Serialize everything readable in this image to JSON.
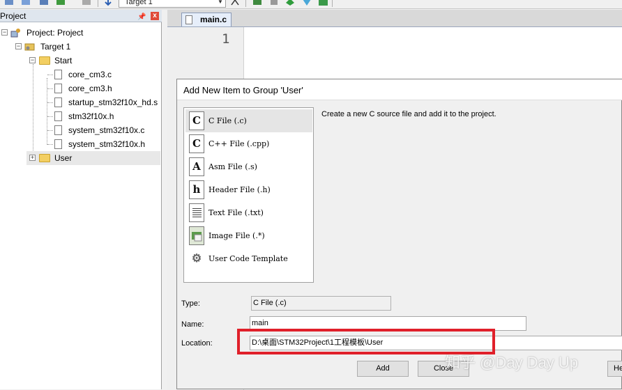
{
  "toolbar": {
    "target_select": "Target 1"
  },
  "project_pane": {
    "title": "Project",
    "pin": "ᵖ",
    "close": "x",
    "tree": {
      "root": "Project: Project",
      "target": "Target 1",
      "group_start": "Start",
      "files": [
        "core_cm3.c",
        "core_cm3.h",
        "startup_stm32f10x_hd.s",
        "stm32f10x.h",
        "system_stm32f10x.c",
        "system_stm32f10x.h"
      ],
      "group_user": "User"
    }
  },
  "editor": {
    "tab_label": "main.c",
    "line_number": "1"
  },
  "dialog": {
    "title": "Add New Item to Group 'User'",
    "items": [
      {
        "label": "C File (.c)",
        "icon": "C"
      },
      {
        "label": "C++ File (.cpp)",
        "icon": "C"
      },
      {
        "label": "Asm File (.s)",
        "icon": "A"
      },
      {
        "label": "Header File (.h)",
        "icon": "h"
      },
      {
        "label": "Text File (.txt)",
        "icon": ""
      },
      {
        "label": "Image File (.*)",
        "icon": ""
      },
      {
        "label": "User Code Template",
        "icon": "⚙"
      }
    ],
    "description": "Create a new C source file and add it to the project.",
    "type_label": "Type:",
    "type_value": "C File (.c)",
    "name_label": "Name:",
    "name_value": "main",
    "location_label": "Location:",
    "location_value": "D:\\桌面\\STM32Project\\1工程模板\\User",
    "add_button": "Add",
    "close_button": "Close",
    "help_button": "He"
  },
  "watermark": "知乎 @Day Day Up",
  "colors": {
    "highlight": "#e0202a",
    "pane_header": "#dfe6ee",
    "folder": "#f3cf62"
  }
}
